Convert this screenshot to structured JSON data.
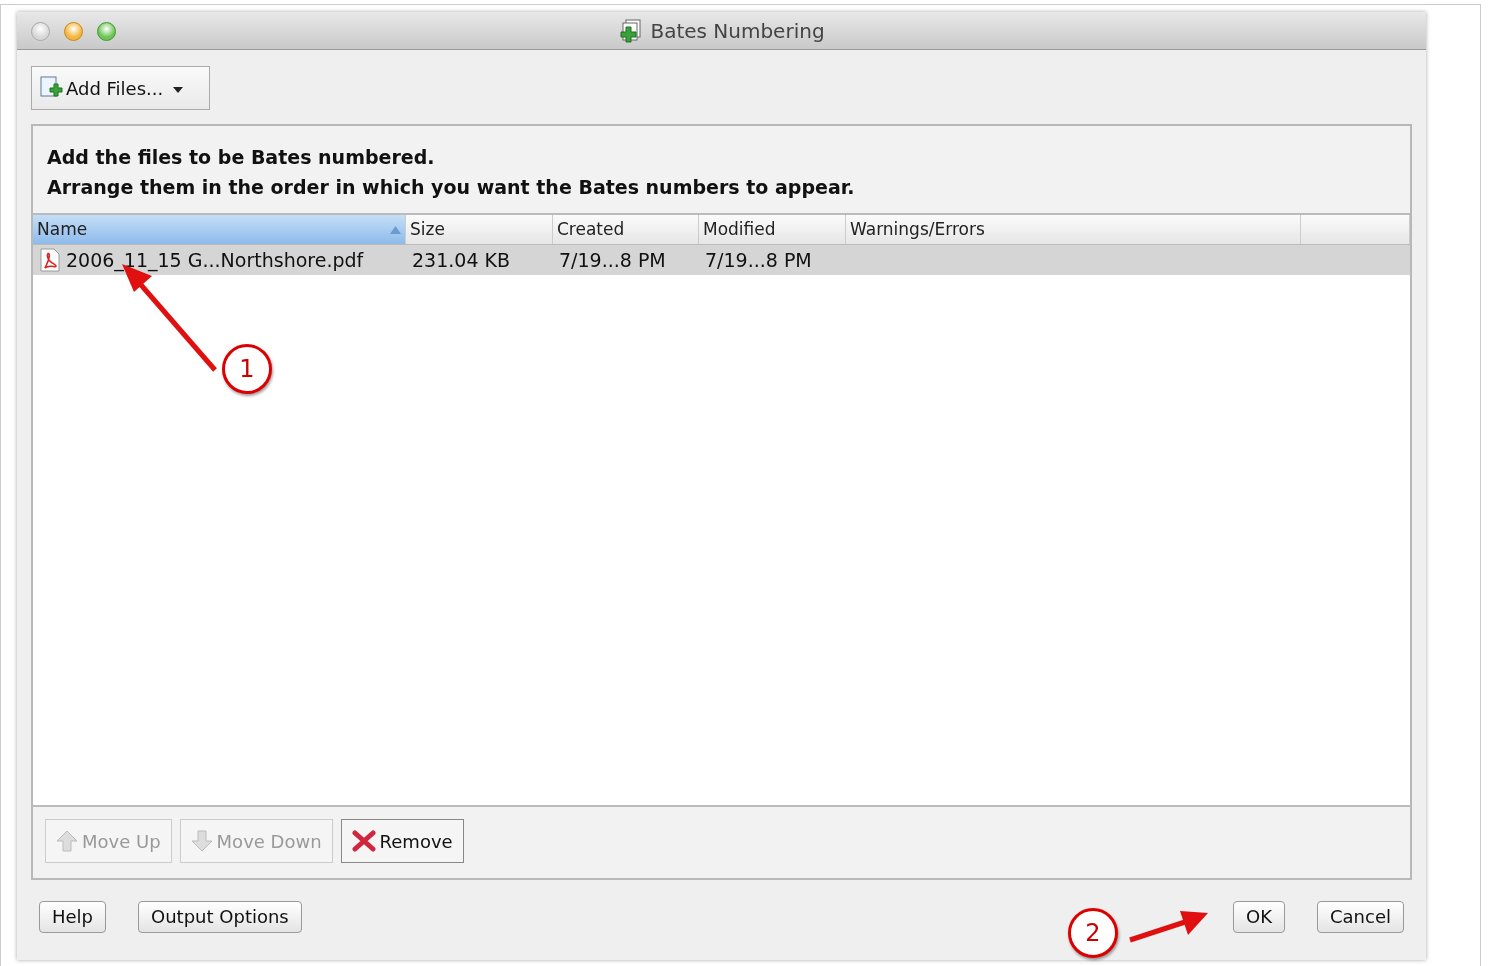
{
  "window": {
    "title": "Bates Numbering"
  },
  "toolbar": {
    "add_files": {
      "label": "Add Files..."
    }
  },
  "instructions": [
    "Add the files to be Bates numbered.",
    "Arrange them in the order in which you want the Bates numbers to appear."
  ],
  "table": {
    "columns": [
      {
        "label": "Name",
        "sorted": true
      },
      {
        "label": "Size",
        "sorted": false
      },
      {
        "label": "Created",
        "sorted": false
      },
      {
        "label": "Modified",
        "sorted": false
      },
      {
        "label": "Warnings/Errors",
        "sorted": false
      }
    ],
    "rows": [
      {
        "cells": [
          "2006_11_15 G...Northshore.pdf",
          "231.04 KB",
          "7/19...8 PM",
          "7/19...8 PM"
        ],
        "selected": true
      }
    ]
  },
  "list_buttons": [
    {
      "kind": "up",
      "label": "Move Up",
      "disabled": true
    },
    {
      "kind": "down",
      "label": "Move Down",
      "disabled": true
    },
    {
      "kind": "remove",
      "label": "Remove",
      "disabled": false
    }
  ],
  "footer": {
    "left": [
      "Help",
      "Output Options"
    ],
    "right": [
      "OK",
      "Cancel"
    ]
  },
  "annotations": [
    {
      "label": "1"
    },
    {
      "label": "2"
    }
  ]
}
